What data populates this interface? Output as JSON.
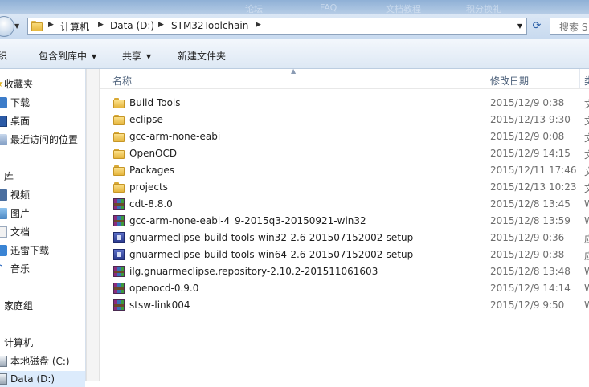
{
  "window": {
    "top_strip_faded": [
      "论坛",
      "FAQ",
      "文档教程",
      "积分换礼"
    ]
  },
  "address": {
    "crumbs": [
      "计算机",
      "Data (D:)",
      "STM32Toolchain"
    ],
    "search_placeholder": "搜索 S"
  },
  "toolbar": {
    "organize_tail": "织",
    "include_library": "包含到库中",
    "share": "共享",
    "new_folder": "新建文件夹"
  },
  "sidebar": {
    "items": [
      {
        "label": "收藏夹",
        "icon": "star-icon"
      },
      {
        "label": "下载",
        "icon": "download-folder-icon"
      },
      {
        "label": "桌面",
        "icon": "desktop-icon"
      },
      {
        "label": "最近访问的位置",
        "icon": "recent-places-icon"
      },
      {
        "label": "库",
        "icon": "libraries-icon"
      },
      {
        "label": "视频",
        "icon": "video-library-icon"
      },
      {
        "label": "图片",
        "icon": "pictures-library-icon"
      },
      {
        "label": "文档",
        "icon": "documents-library-icon"
      },
      {
        "label": "迅雷下载",
        "icon": "thunder-download-icon"
      },
      {
        "label": "音乐",
        "icon": "music-library-icon"
      },
      {
        "label": "家庭组",
        "icon": "homegroup-icon"
      },
      {
        "label": "计算机",
        "icon": "computer-icon"
      },
      {
        "label": "本地磁盘 (C:)",
        "icon": "drive-icon"
      },
      {
        "label": "Data (D:)",
        "icon": "drive-icon"
      }
    ]
  },
  "columns": {
    "name": "名称",
    "date": "修改日期",
    "type_tail": "类"
  },
  "files": [
    {
      "name": "Build Tools",
      "date": "2015/12/9 0:38",
      "type": "文",
      "icon": "folder"
    },
    {
      "name": "eclipse",
      "date": "2015/12/13 9:30",
      "type": "文",
      "icon": "folder"
    },
    {
      "name": "gcc-arm-none-eabi",
      "date": "2015/12/9 0:08",
      "type": "文",
      "icon": "folder"
    },
    {
      "name": "OpenOCD",
      "date": "2015/12/9 14:15",
      "type": "文",
      "icon": "folder"
    },
    {
      "name": "Packages",
      "date": "2015/12/11 17:46",
      "type": "文",
      "icon": "folder"
    },
    {
      "name": "projects",
      "date": "2015/12/13 10:23",
      "type": "文",
      "icon": "folder"
    },
    {
      "name": "cdt-8.8.0",
      "date": "2015/12/8 13:45",
      "type": "W",
      "icon": "rar"
    },
    {
      "name": "gcc-arm-none-eabi-4_9-2015q3-20150921-win32",
      "date": "2015/12/8 13:59",
      "type": "W",
      "icon": "rar"
    },
    {
      "name": "gnuarmeclipse-build-tools-win32-2.6-201507152002-setup",
      "date": "2015/12/9 0:36",
      "type": "应",
      "icon": "exe"
    },
    {
      "name": "gnuarmeclipse-build-tools-win64-2.6-201507152002-setup",
      "date": "2015/12/9 0:38",
      "type": "应",
      "icon": "exe"
    },
    {
      "name": "ilg.gnuarmeclipse.repository-2.10.2-201511061603",
      "date": "2015/12/8 13:48",
      "type": "W",
      "icon": "rar"
    },
    {
      "name": "openocd-0.9.0",
      "date": "2015/12/9 14:14",
      "type": "W",
      "icon": "rar"
    },
    {
      "name": "stsw-link004",
      "date": "2015/12/9 9:50",
      "type": "W",
      "icon": "rar"
    }
  ]
}
